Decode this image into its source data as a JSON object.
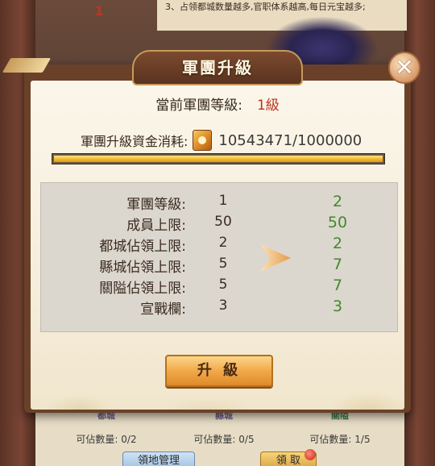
{
  "background": {
    "top_text": "3、占领都城数量越多,官职体系越高,每日元宝越多;",
    "left_number": "1",
    "footer": [
      {
        "name": "都城",
        "count_label": "可佔數量: 0/2"
      },
      {
        "name": "縣城",
        "count_label": "可佔數量: 0/5"
      },
      {
        "name": "關隘",
        "count_label": "可佔數量: 1/5"
      }
    ],
    "buttons": {
      "territory": "領地管理",
      "claim": "領 取"
    }
  },
  "dialog": {
    "title": "軍團升級",
    "current_level_label": "當前軍團等級:",
    "current_level_value": "1級",
    "cost_label": "軍團升級資金消耗:",
    "cost_value": "10543471/1000000",
    "progress_fraction": 1.0,
    "stats": [
      {
        "label": "軍團等級:",
        "current": "1",
        "next": "2"
      },
      {
        "label": "成員上限:",
        "current": "50",
        "next": "50"
      },
      {
        "label": "都城佔領上限:",
        "current": "2",
        "next": "2"
      },
      {
        "label": "縣城佔領上限:",
        "current": "5",
        "next": "7"
      },
      {
        "label": "關隘佔領上限:",
        "current": "5",
        "next": "7"
      },
      {
        "label": "宣戰欄:",
        "current": "3",
        "next": "3"
      }
    ],
    "upgrade_button": "升 級"
  },
  "icons": {
    "close": "close-icon",
    "cost": "gold-token-icon",
    "arrow": "arrow-right-icon"
  },
  "colors": {
    "level_value": "#c0321f",
    "next_value": "#3f8a2a",
    "progress_fill": "#f3b62a"
  }
}
